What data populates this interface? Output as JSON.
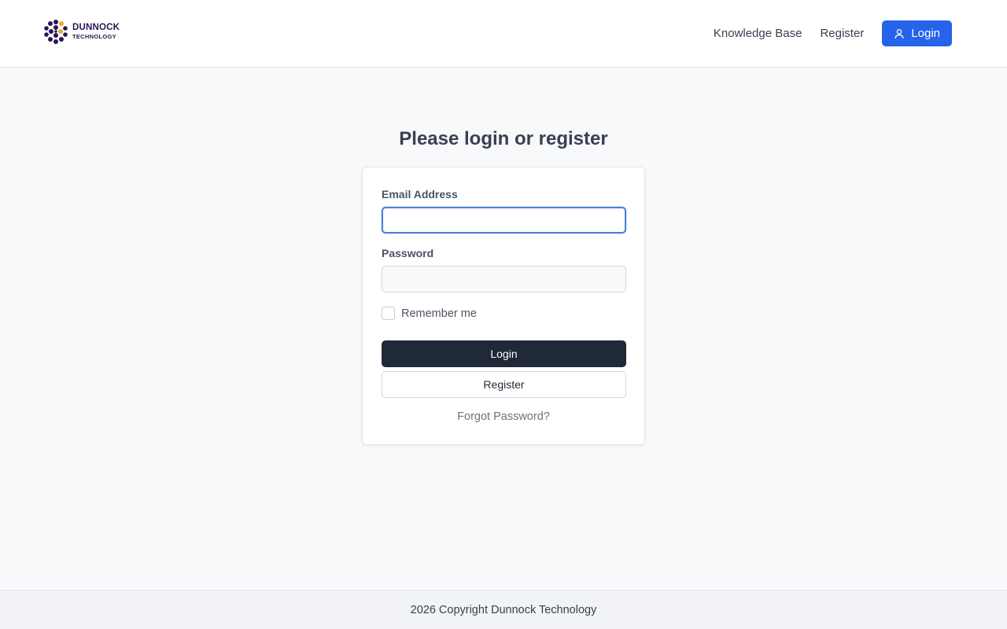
{
  "header": {
    "logo": {
      "line1": "DUNNOCK",
      "line2": "TECHNOLOGY",
      "accent": "#f5a623",
      "primary": "#2b1458"
    },
    "nav": {
      "knowledge_base": "Knowledge Base",
      "register": "Register",
      "login": "Login",
      "login_icon": "user-icon"
    }
  },
  "main": {
    "title": "Please login or register",
    "form": {
      "email_label": "Email Address",
      "email_value": "",
      "password_label": "Password",
      "password_value": "",
      "remember_label": "Remember me",
      "remember_checked": false,
      "login_button": "Login",
      "register_button": "Register",
      "forgot_link": "Forgot Password?"
    }
  },
  "footer": {
    "copyright": "2026 Copyright Dunnock Technology"
  },
  "colors": {
    "primary_button": "#2563eb",
    "dark_button": "#1f2937",
    "background": "#f8f9fb"
  }
}
